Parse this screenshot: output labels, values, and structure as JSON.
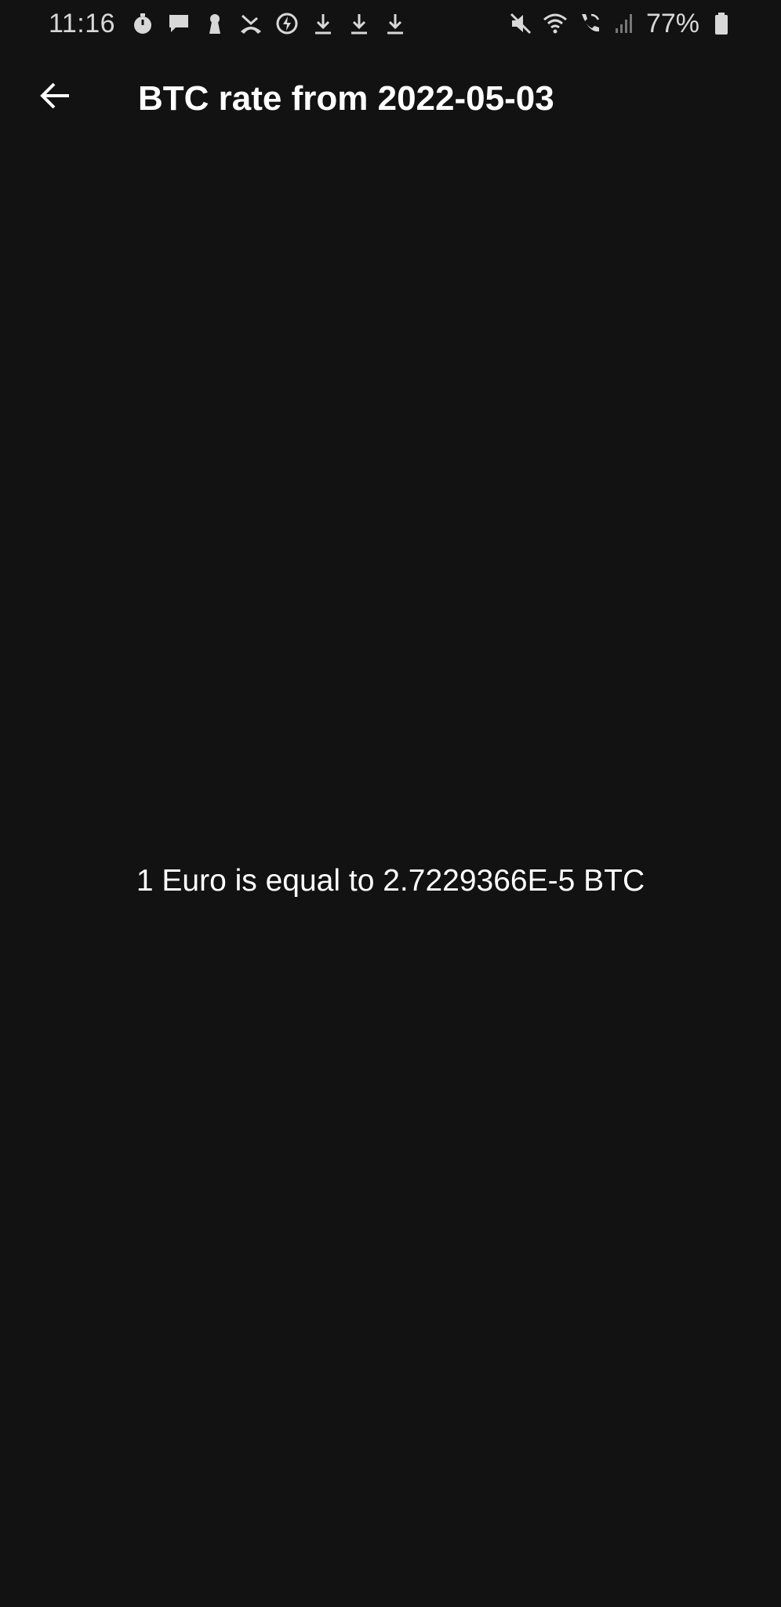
{
  "status_bar": {
    "time": "11:16",
    "left_icons": [
      "stopwatch-icon",
      "message-icon",
      "keyhole-icon",
      "missed-call-icon",
      "power-saving-icon",
      "download-icon",
      "download-icon",
      "download-icon"
    ],
    "right_icons": [
      "mute-icon",
      "wifi-icon",
      "wifi-call-icon",
      "signal-icon",
      "battery-icon"
    ],
    "battery_percent": "77%"
  },
  "app_bar": {
    "title": "BTC rate from 2022-05-03"
  },
  "content": {
    "rate_text": "1 Euro is equal to 2.7229366E-5 BTC"
  },
  "colors": {
    "background": "#121212",
    "text": "#ffffff",
    "status_text": "#d8d8d8"
  }
}
